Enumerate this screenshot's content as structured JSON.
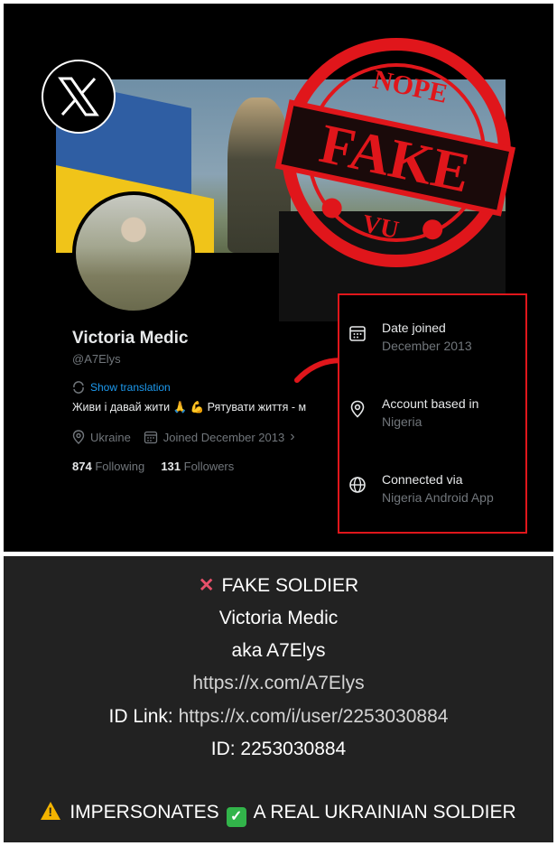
{
  "stamp": {
    "top": "NOPE",
    "main": "FAKE",
    "bottom": "VU"
  },
  "profile": {
    "name": "Victoria Medic",
    "handle": "@A7Elys",
    "translate": "Show translation",
    "bio": "Живи і давай жити 🙏 💪 Рятувати життя - м",
    "location": "Ukraine",
    "joined": "Joined December 2013",
    "following_count": "874",
    "following_label": "Following",
    "followers_count": "131",
    "followers_label": "Followers"
  },
  "info_box": {
    "items": [
      {
        "icon": "calendar-icon",
        "label": "Date joined",
        "value": "December 2013"
      },
      {
        "icon": "location-icon",
        "label": "Account based in",
        "value": "Nigeria"
      },
      {
        "icon": "globe-icon",
        "label": "Connected via",
        "value": "Nigeria Android App"
      }
    ]
  },
  "caption": {
    "line1": "FAKE SOLDIER",
    "line2": "Victoria Medic",
    "line3": "aka A7Elys",
    "line4": "https://x.com/A7Elys",
    "line5_prefix": "ID Link:",
    "line5_link": "https://x.com/i/user/2253030884",
    "line6": "ID: 2253030884",
    "line7_a": "IMPERSONATES",
    "line7_b": "A REAL UKRAINIAN SOLDIER"
  },
  "colors": {
    "stamp_red": "#e0161b",
    "x_blue": "#1d9bf0",
    "panel_bg": "#222222"
  }
}
